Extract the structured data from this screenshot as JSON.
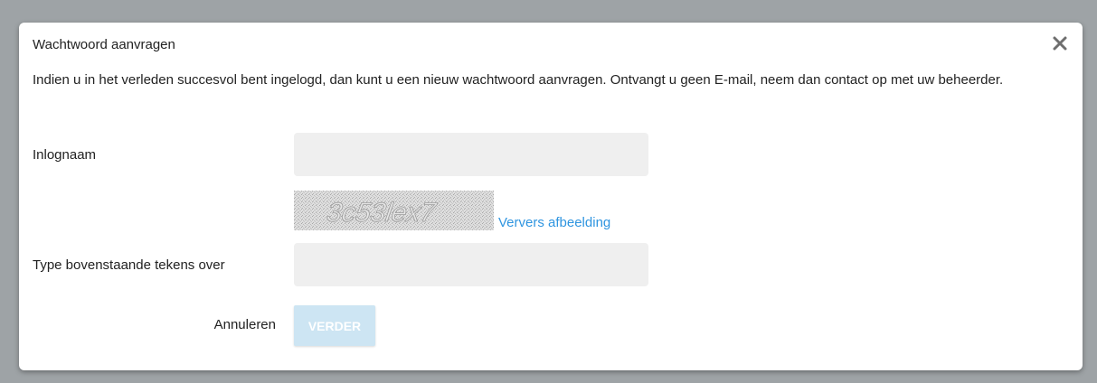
{
  "dialog": {
    "title": "Wachtwoord aanvragen",
    "close_icon": "close-icon",
    "intro": "Indien u in het verleden succesvol bent ingelogd, dan kunt u een nieuw wachtwoord aanvragen. Ontvangt u geen E-mail, neem dan contact op met uw beheerder."
  },
  "form": {
    "username": {
      "label": "Inlognaam",
      "value": "",
      "placeholder": ""
    },
    "captcha": {
      "text": "3c53lex7",
      "refresh_label": "Ververs afbeelding"
    },
    "captcha_input": {
      "label": "Type bovenstaande tekens over",
      "value": "",
      "placeholder": ""
    },
    "actions": {
      "cancel_label": "Annuleren",
      "next_label": "VERDER"
    }
  },
  "colors": {
    "backdrop": "#9ea3a6",
    "input_background": "#efefef",
    "link": "#2f95e0",
    "button_disabled": "#cde5f3"
  }
}
